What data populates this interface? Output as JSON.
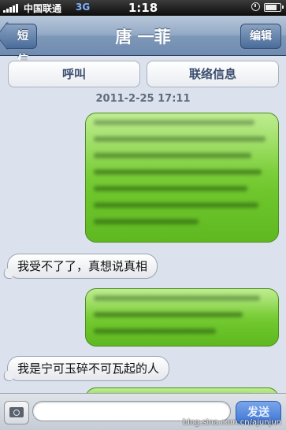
{
  "status_bar": {
    "carrier": "中国联通",
    "network": "3G",
    "time": "1:18"
  },
  "nav": {
    "back_label": "短信",
    "title": "唐 一菲",
    "edit_label": "编辑"
  },
  "actions": {
    "call_label": "呼叫",
    "contact_label": "联络信息"
  },
  "timestamp": "2011-2-25 17:11",
  "messages": [
    {
      "direction": "outgoing",
      "text": "",
      "blurred": true
    },
    {
      "direction": "incoming",
      "text": "我受不了了，真想说真相"
    },
    {
      "direction": "outgoing",
      "text": "",
      "blurred": true
    },
    {
      "direction": "incoming",
      "text": "我是宁可玉碎不可瓦起的人"
    },
    {
      "direction": "outgoing",
      "text": "",
      "blurred": true
    }
  ],
  "compose": {
    "input_value": "",
    "send_label": "发送"
  },
  "watermark": "blog.sina.com.cn/ajunjun",
  "colors": {
    "nav_bar": "#7e98b8",
    "outgoing_bubble": "#6fc72d",
    "background": "#dbe2ed"
  }
}
